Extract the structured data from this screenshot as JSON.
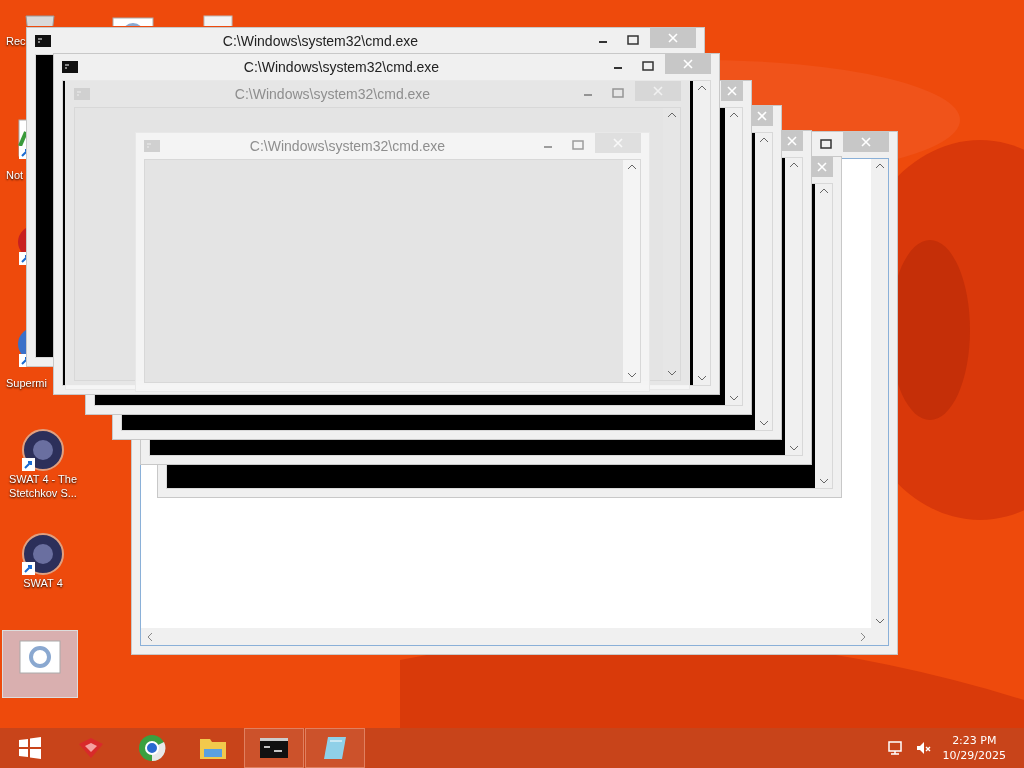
{
  "desktop": {
    "icons": [
      {
        "kind": "recycle",
        "label": "Rec",
        "selected": false
      },
      {
        "kind": "settings",
        "selected": false
      },
      {
        "kind": "document",
        "selected": false
      },
      {
        "kind": "notepad",
        "label": "Not",
        "selected": false
      },
      {
        "kind": "game-red",
        "selected": false
      },
      {
        "kind": "game-blue",
        "label": "Supermi",
        "selected": false
      },
      {
        "kind": "swat",
        "label": "SWAT 4 - The Stetchkov S...",
        "selected": false
      },
      {
        "kind": "swat",
        "label": "SWAT 4",
        "selected": false
      },
      {
        "kind": "settings",
        "selected": true
      }
    ]
  },
  "windows": [
    {
      "kind": "editor",
      "faded": false
    },
    {
      "kind": "console",
      "faded": false
    },
    {
      "kind": "console",
      "faded": false
    },
    {
      "kind": "console",
      "faded": false
    },
    {
      "kind": "console",
      "faded": false
    },
    {
      "kind": "console",
      "title": "C:\\Windows\\system32\\cmd.exe",
      "faded": false
    },
    {
      "kind": "console",
      "title": "C:\\Windows\\system32\\cmd.exe",
      "faded": false
    },
    {
      "kind": "console",
      "title": "C:\\Windows\\system32\\cmd.exe",
      "faded": true
    },
    {
      "kind": "console",
      "title": "C:\\Windows\\system32\\cmd.exe",
      "faded": true
    }
  ],
  "taskbar": {
    "items": [
      {
        "kind": "start",
        "running": false
      },
      {
        "kind": "toolbox",
        "running": false
      },
      {
        "kind": "browser",
        "running": false
      },
      {
        "kind": "folder",
        "running": false
      },
      {
        "kind": "console",
        "running": true
      },
      {
        "kind": "notepad",
        "running": true
      }
    ],
    "tray": {
      "time": "2:23 PM",
      "date": "10/29/2025"
    }
  }
}
